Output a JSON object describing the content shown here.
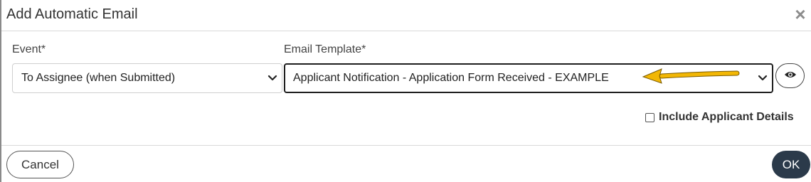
{
  "dialog": {
    "title": "Add Automatic Email",
    "close_icon": "close-icon"
  },
  "event_field": {
    "label": "Event*",
    "selected": "To Assignee (when Submitted)",
    "icon": "chevron-down-icon"
  },
  "template_field": {
    "label": "Email Template*",
    "selected": "Applicant Notification - Application Form Received - EXAMPLE",
    "icon": "chevron-down-icon"
  },
  "preview_button": {
    "icon": "eye-icon"
  },
  "include_details": {
    "label": "Include Applicant Details",
    "checked": false
  },
  "footer": {
    "cancel_label": "Cancel",
    "ok_label": "OK"
  },
  "annotation": {
    "arrow_color": "#f2b705",
    "icon": "arrow-left-icon"
  },
  "colors": {
    "ok_button_bg": "#2b3a4a",
    "focus_border": "#1e1e1e"
  }
}
